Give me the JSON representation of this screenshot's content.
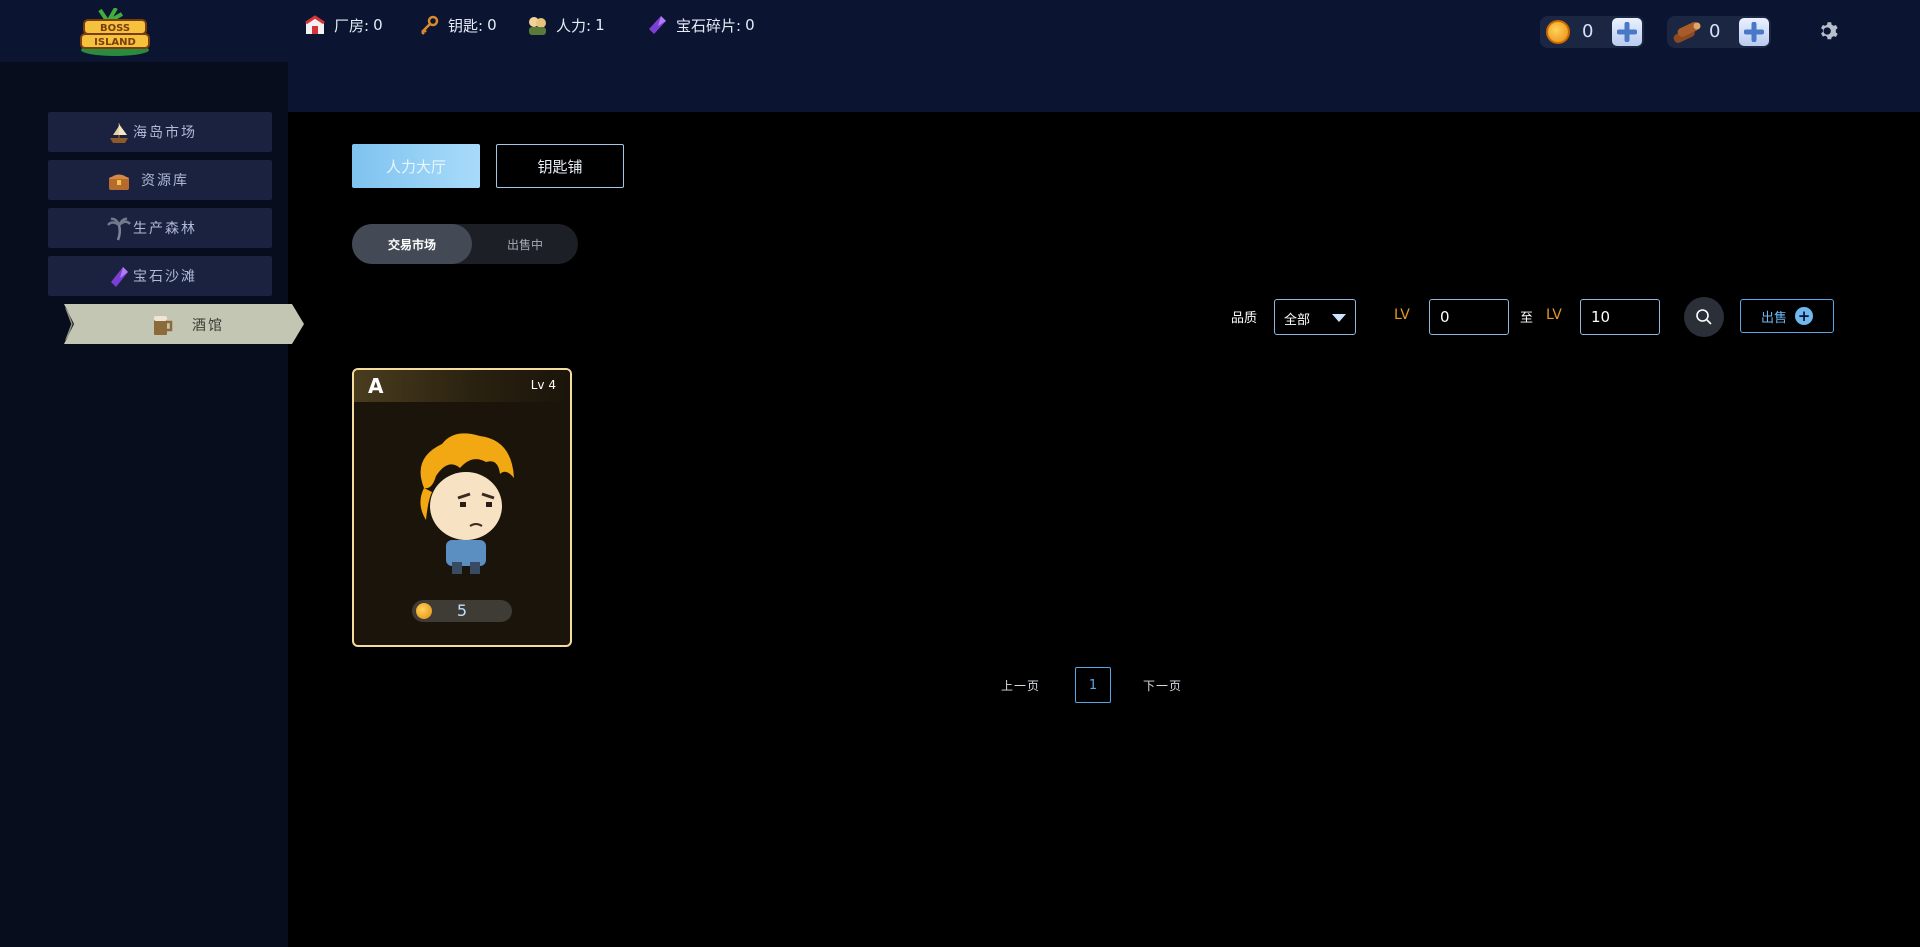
{
  "header": {
    "logo_alt": "BOSS ISLAND",
    "coin_count": "0",
    "wood_count": "0"
  },
  "stats": [
    {
      "label": "厂房:",
      "value": "0"
    },
    {
      "label": "钥匙:",
      "value": "0"
    },
    {
      "label": "人力:",
      "value": "1"
    },
    {
      "label": "宝石碎片:",
      "value": "0"
    }
  ],
  "sidebar": {
    "items": [
      {
        "label": "海岛市场",
        "icon": "ship-icon"
      },
      {
        "label": "资源库",
        "icon": "treasure-chest-icon"
      },
      {
        "label": "生产森林",
        "icon": "palm-tree-icon"
      },
      {
        "label": "宝石沙滩",
        "icon": "gem-icon"
      },
      {
        "label": "酒馆",
        "icon": "beer-mug-icon"
      }
    ],
    "active_index": 4
  },
  "tabs": [
    {
      "label": "人力大厅",
      "active": true
    },
    {
      "label": "钥匙铺",
      "active": false
    }
  ],
  "segment": {
    "options": [
      "交易市场",
      "出售中"
    ],
    "selected": "交易市场"
  },
  "filters": {
    "quality_label": "品质",
    "quality_value": "全部",
    "lv_label": "LV",
    "lv_from": "0",
    "to_label": "至",
    "lv_to": "10",
    "sell_label": "出售"
  },
  "cards": [
    {
      "grade": "A",
      "level": "Lv 4",
      "price": "5"
    }
  ],
  "pagination": {
    "prev": "上一页",
    "current": "1",
    "next": "下一页"
  },
  "colors": {
    "topbar": "#0b1430",
    "accent_blue": "#5aa6e6",
    "lv_orange": "#e19a2a",
    "card_border": "#f3dc9e"
  }
}
